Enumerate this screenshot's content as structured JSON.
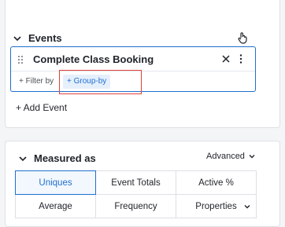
{
  "events_panel": {
    "title": "Events",
    "event": {
      "name": "Complete Class Booking",
      "filter_label": "+ Filter by",
      "group_label": "+ Group-by"
    },
    "add_event_label": "+ Add Event"
  },
  "measured_panel": {
    "title": "Measured as",
    "advanced_label": "Advanced",
    "options": [
      {
        "label": "Uniques",
        "selected": true
      },
      {
        "label": "Event Totals",
        "selected": false
      },
      {
        "label": "Active %",
        "selected": false
      },
      {
        "label": "Average",
        "selected": false
      },
      {
        "label": "Frequency",
        "selected": false
      },
      {
        "label": "Properties",
        "selected": false,
        "has_dropdown": true
      }
    ]
  },
  "colors": {
    "accent": "#1f6fd0",
    "highlight": "#e0413a",
    "background": "#f4f5f7"
  }
}
